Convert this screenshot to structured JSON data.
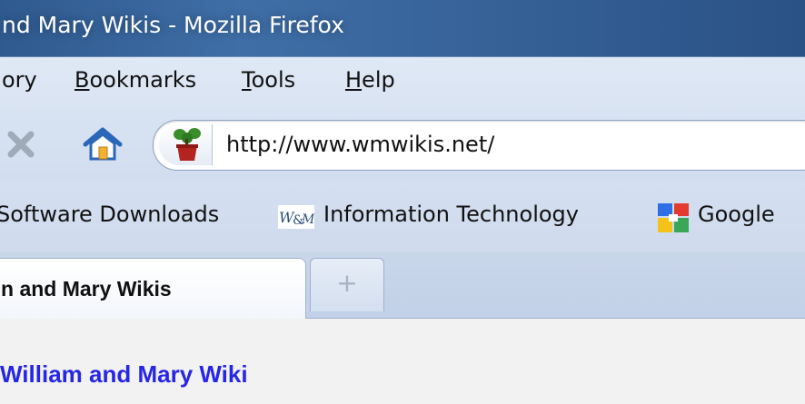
{
  "window": {
    "title": "nd Mary Wikis - Mozilla Firefox"
  },
  "menubar": {
    "items": [
      {
        "pre": "",
        "key": "",
        "post": "ory"
      },
      {
        "pre": "",
        "key": "B",
        "post": "ookmarks"
      },
      {
        "pre": "",
        "key": "T",
        "post": "ools"
      },
      {
        "pre": "",
        "key": "H",
        "post": "elp"
      }
    ]
  },
  "navbar": {
    "url": "http://www.wmwikis.net/",
    "icons": [
      "stop-icon",
      "home-icon",
      "site-favicon"
    ]
  },
  "bookmarks": {
    "items": [
      {
        "label": "Software Downloads"
      },
      {
        "label": "Information Technology",
        "icon": "wm-icon"
      },
      {
        "label": "Google",
        "icon": "google-icon"
      }
    ]
  },
  "tabs": {
    "active_label": "n and Mary Wikis",
    "new_tab_symbol": "+"
  },
  "content": {
    "heading": "William and Mary Wiki"
  },
  "colors": {
    "heading": "#2626e6",
    "titlebar": "#2f5a8f"
  }
}
